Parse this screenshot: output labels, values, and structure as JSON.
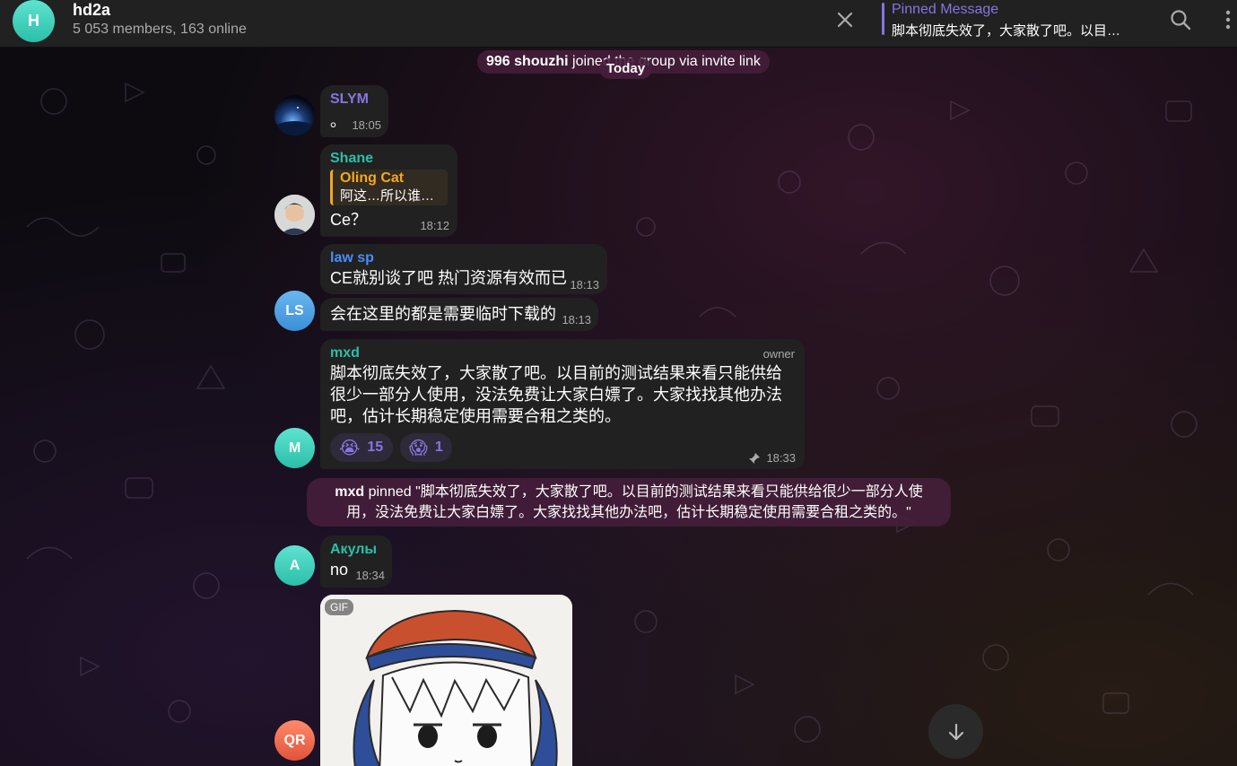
{
  "header": {
    "avatar_letter": "H",
    "title": "hd2a",
    "subtitle": "5 053 members, 163 online",
    "pinned_title": "Pinned Message",
    "pinned_text": "脚本彻底失效了，大家散了吧。以目…"
  },
  "service": {
    "joined_name": "996 shouzhi",
    "joined_text": " joined the group via invite link",
    "today": "Today",
    "pinned_name": "mxd",
    "pinned_line1": " pinned \"脚本彻底失效了，大家散了吧。以目前的测试结果来看只能供给很少一部分人使",
    "pinned_line2": "用，没法免费让大家白嫖了。大家找找其他办法吧，估计长期稳定使用需要合租之类的。\""
  },
  "messages": {
    "slym": {
      "sender": "SLYM",
      "text": "。",
      "time": "18:05"
    },
    "shane": {
      "sender": "Shane",
      "reply_name": "Oling Cat",
      "reply_text": "阿这…所以谁…",
      "text": "Ce？",
      "time": "18:12"
    },
    "lawsp": {
      "avatar": "LS",
      "sender": "law sp",
      "text1": "CE就别谈了吧 热门资源有效而已",
      "time1": "18:13",
      "text2": "会在这里的都是需要临时下载的",
      "time2": "18:13"
    },
    "mxd": {
      "avatar": "M",
      "sender": "mxd",
      "badge": "owner",
      "line1": "脚本彻底失效了，大家散了吧。以目前的测试结果来看只能供给",
      "line2": "很少一部分人使用，没法免费让大家白嫖了。大家找找其他办法",
      "line3": "吧，估计长期稳定使用需要合租之类的。",
      "reactions": [
        {
          "emoji": "😭",
          "count": "15"
        },
        {
          "emoji": "😱",
          "count": "1"
        }
      ],
      "time": "18:33"
    },
    "akuly": {
      "avatar": "A",
      "sender": "Акулы",
      "text": "no",
      "time": "18:34"
    },
    "qr": {
      "avatar": "QR",
      "gif_badge": "GIF"
    }
  },
  "colors": {
    "accent": "#8774e1",
    "sender_slym": "#8774e1",
    "sender_shane": "#2bbfa9",
    "sender_lawsp": "#4b8df8",
    "sender_mxd": "#2bbfa9",
    "sender_akuly": "#2bbfa9",
    "reply_accent": "#f5a623"
  },
  "icons": {
    "close": "close-icon",
    "search": "search-icon",
    "more": "more-vertical-icon",
    "pin": "pin-icon",
    "scroll": "arrow-down-icon"
  }
}
